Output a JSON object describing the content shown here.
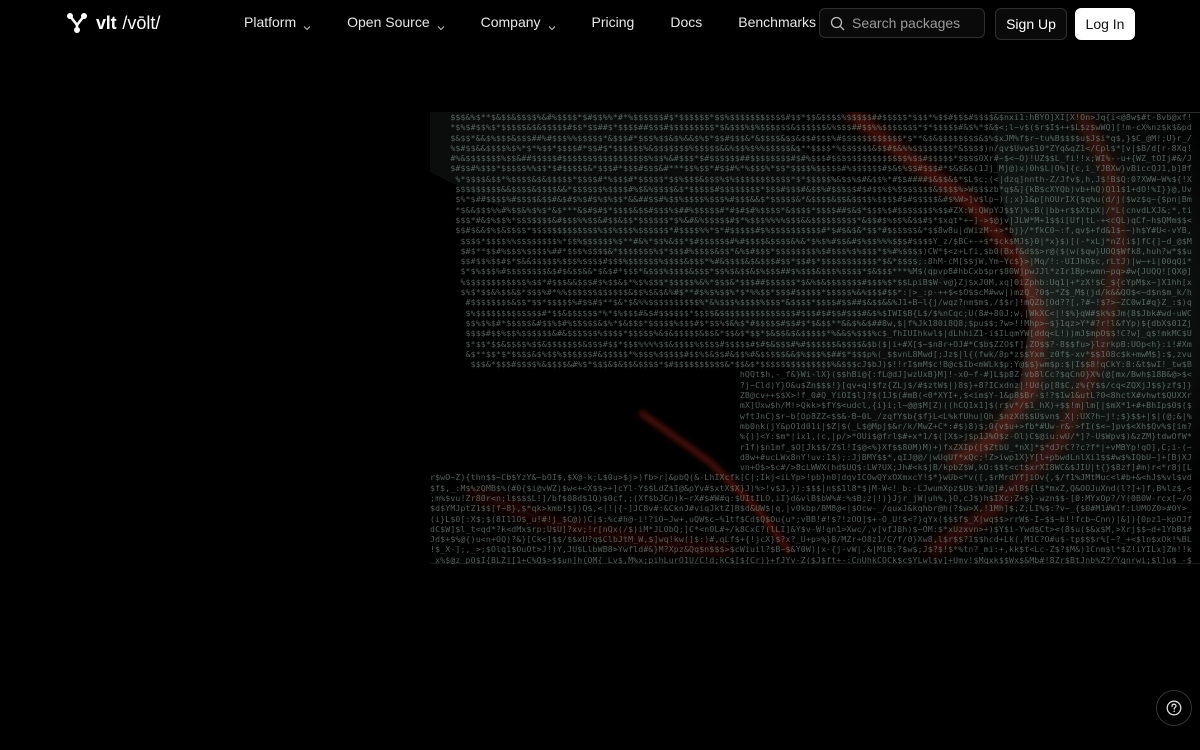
{
  "brand": {
    "name": "vlt",
    "pronunciation": "/vōlt/",
    "logo_icon": "vlt-logo-icon"
  },
  "nav": {
    "items": [
      {
        "label": "Platform",
        "has_dropdown": true,
        "icon": "chevron-down-icon"
      },
      {
        "label": "Open Source",
        "has_dropdown": true,
        "icon": "chevron-down-icon"
      },
      {
        "label": "Company",
        "has_dropdown": true,
        "icon": "chevron-down-icon"
      },
      {
        "label": "Pricing",
        "has_dropdown": false
      },
      {
        "label": "Docs",
        "has_dropdown": false
      },
      {
        "label": "Benchmarks",
        "has_dropdown": false
      }
    ]
  },
  "search": {
    "placeholder": "Search packages",
    "value": "",
    "icon": "search-icon"
  },
  "auth": {
    "signup_label": "Sign Up",
    "login_label": "Log In"
  },
  "hero": {
    "art_icon": "ascii-art-hand-image"
  },
  "help": {
    "icon": "question-circle-icon"
  },
  "colors": {
    "background": "#000000",
    "text": "#ffffff",
    "login_bg": "#ffffff",
    "login_text": "#111111",
    "border": "#2e2e2e",
    "art_glow": "#c0392b"
  }
}
